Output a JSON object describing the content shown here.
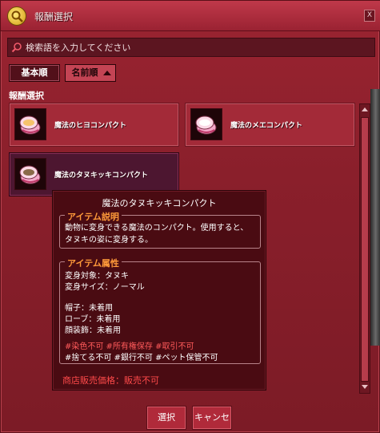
{
  "window": {
    "title": "報酬選択",
    "close_label": "X"
  },
  "search": {
    "placeholder": "検索語を入力してください",
    "value": ""
  },
  "sort": {
    "basic_label": "基本順",
    "name_label": "名前順"
  },
  "section": {
    "label": "報酬選択"
  },
  "items": [
    {
      "name": "魔法のヒヨコンパクト",
      "icon": "compact-icon"
    },
    {
      "name": "魔法のメエコンパクト",
      "icon": "compact-icon"
    },
    {
      "name": "魔法のタヌキッキコンパクト",
      "icon": "compact-icon",
      "selected": true
    }
  ],
  "tooltip": {
    "title": "魔法のタヌキッキコンパクト",
    "desc_tag": "アイテム説明",
    "desc_lines": [
      "動物に変身できる魔法のコンパクト。使用すると、",
      "タヌキの姿に変身する。"
    ],
    "attr_tag": "アイテム属性",
    "attr_lines": [
      "変身対象：タヌキ",
      "変身サイズ：ノーマル",
      "",
      "帽子：未着用",
      "ローブ：未着用",
      "顔装飾：未着用"
    ],
    "flags_line1": "#染色不可 #所有権保存 #取引不可",
    "flags_line2": "#捨てる不可 #銀行不可 #ペット保管不可",
    "price": "商店販売価格：販売不可"
  },
  "buttons": {
    "select_label": "選択",
    "cancel_label": "キャンセル"
  }
}
